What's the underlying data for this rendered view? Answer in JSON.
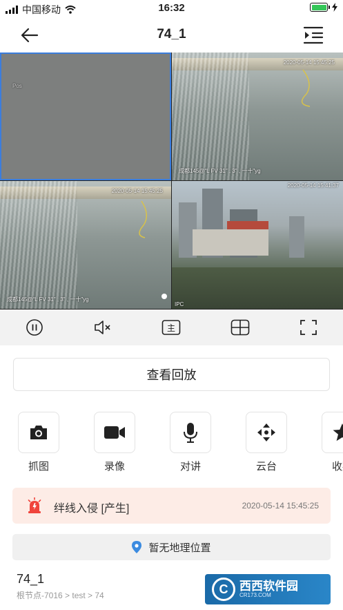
{
  "status_bar": {
    "carrier": "中国移动",
    "time": "16:32",
    "battery_color": "#35c759"
  },
  "nav": {
    "title": "74_1"
  },
  "cameras": [
    {
      "id": "cam1",
      "selected": true,
      "osd_top": "Pos",
      "osd_bottom": ""
    },
    {
      "id": "cam2",
      "selected": false,
      "osd_top": "2020-05-14 15:45:25",
      "osd_bottom": "成都145@“L FV 31\" , 3\" , 一十\"yg"
    },
    {
      "id": "cam3",
      "selected": false,
      "osd_top": "2020-05-14 15:45:25",
      "osd_bottom": "成都145@“L FV 31\" , 3\" , 一十\"yg"
    },
    {
      "id": "cam4",
      "selected": false,
      "osd_top": "2020-05-14 15:41:37",
      "osd_bottom": "IPC"
    }
  ],
  "controls": [
    "pause-icon",
    "mute-icon",
    "main-stream-icon",
    "grid-layout-icon",
    "fullscreen-icon"
  ],
  "controls_main_label": "主",
  "playback_button": "查看回放",
  "actions": [
    {
      "icon": "camera-icon",
      "label": "抓图"
    },
    {
      "icon": "video-record-icon",
      "label": "录像"
    },
    {
      "icon": "microphone-icon",
      "label": "对讲"
    },
    {
      "icon": "ptz-icon",
      "label": "云台"
    },
    {
      "icon": "star-icon",
      "label": "收藏"
    }
  ],
  "alarm": {
    "text": "绊线入侵 [产生]",
    "time": "2020-05-14 15:45:25",
    "color": "#f0443c"
  },
  "geo": {
    "text": "暂无地理位置",
    "pin_color": "#3b8be0"
  },
  "device": {
    "name": "74_1",
    "path": "根节点-7016 > test > 74"
  },
  "watermark": {
    "brand": "西西软件园",
    "sub": "CR173.COM",
    "logo": "C"
  }
}
